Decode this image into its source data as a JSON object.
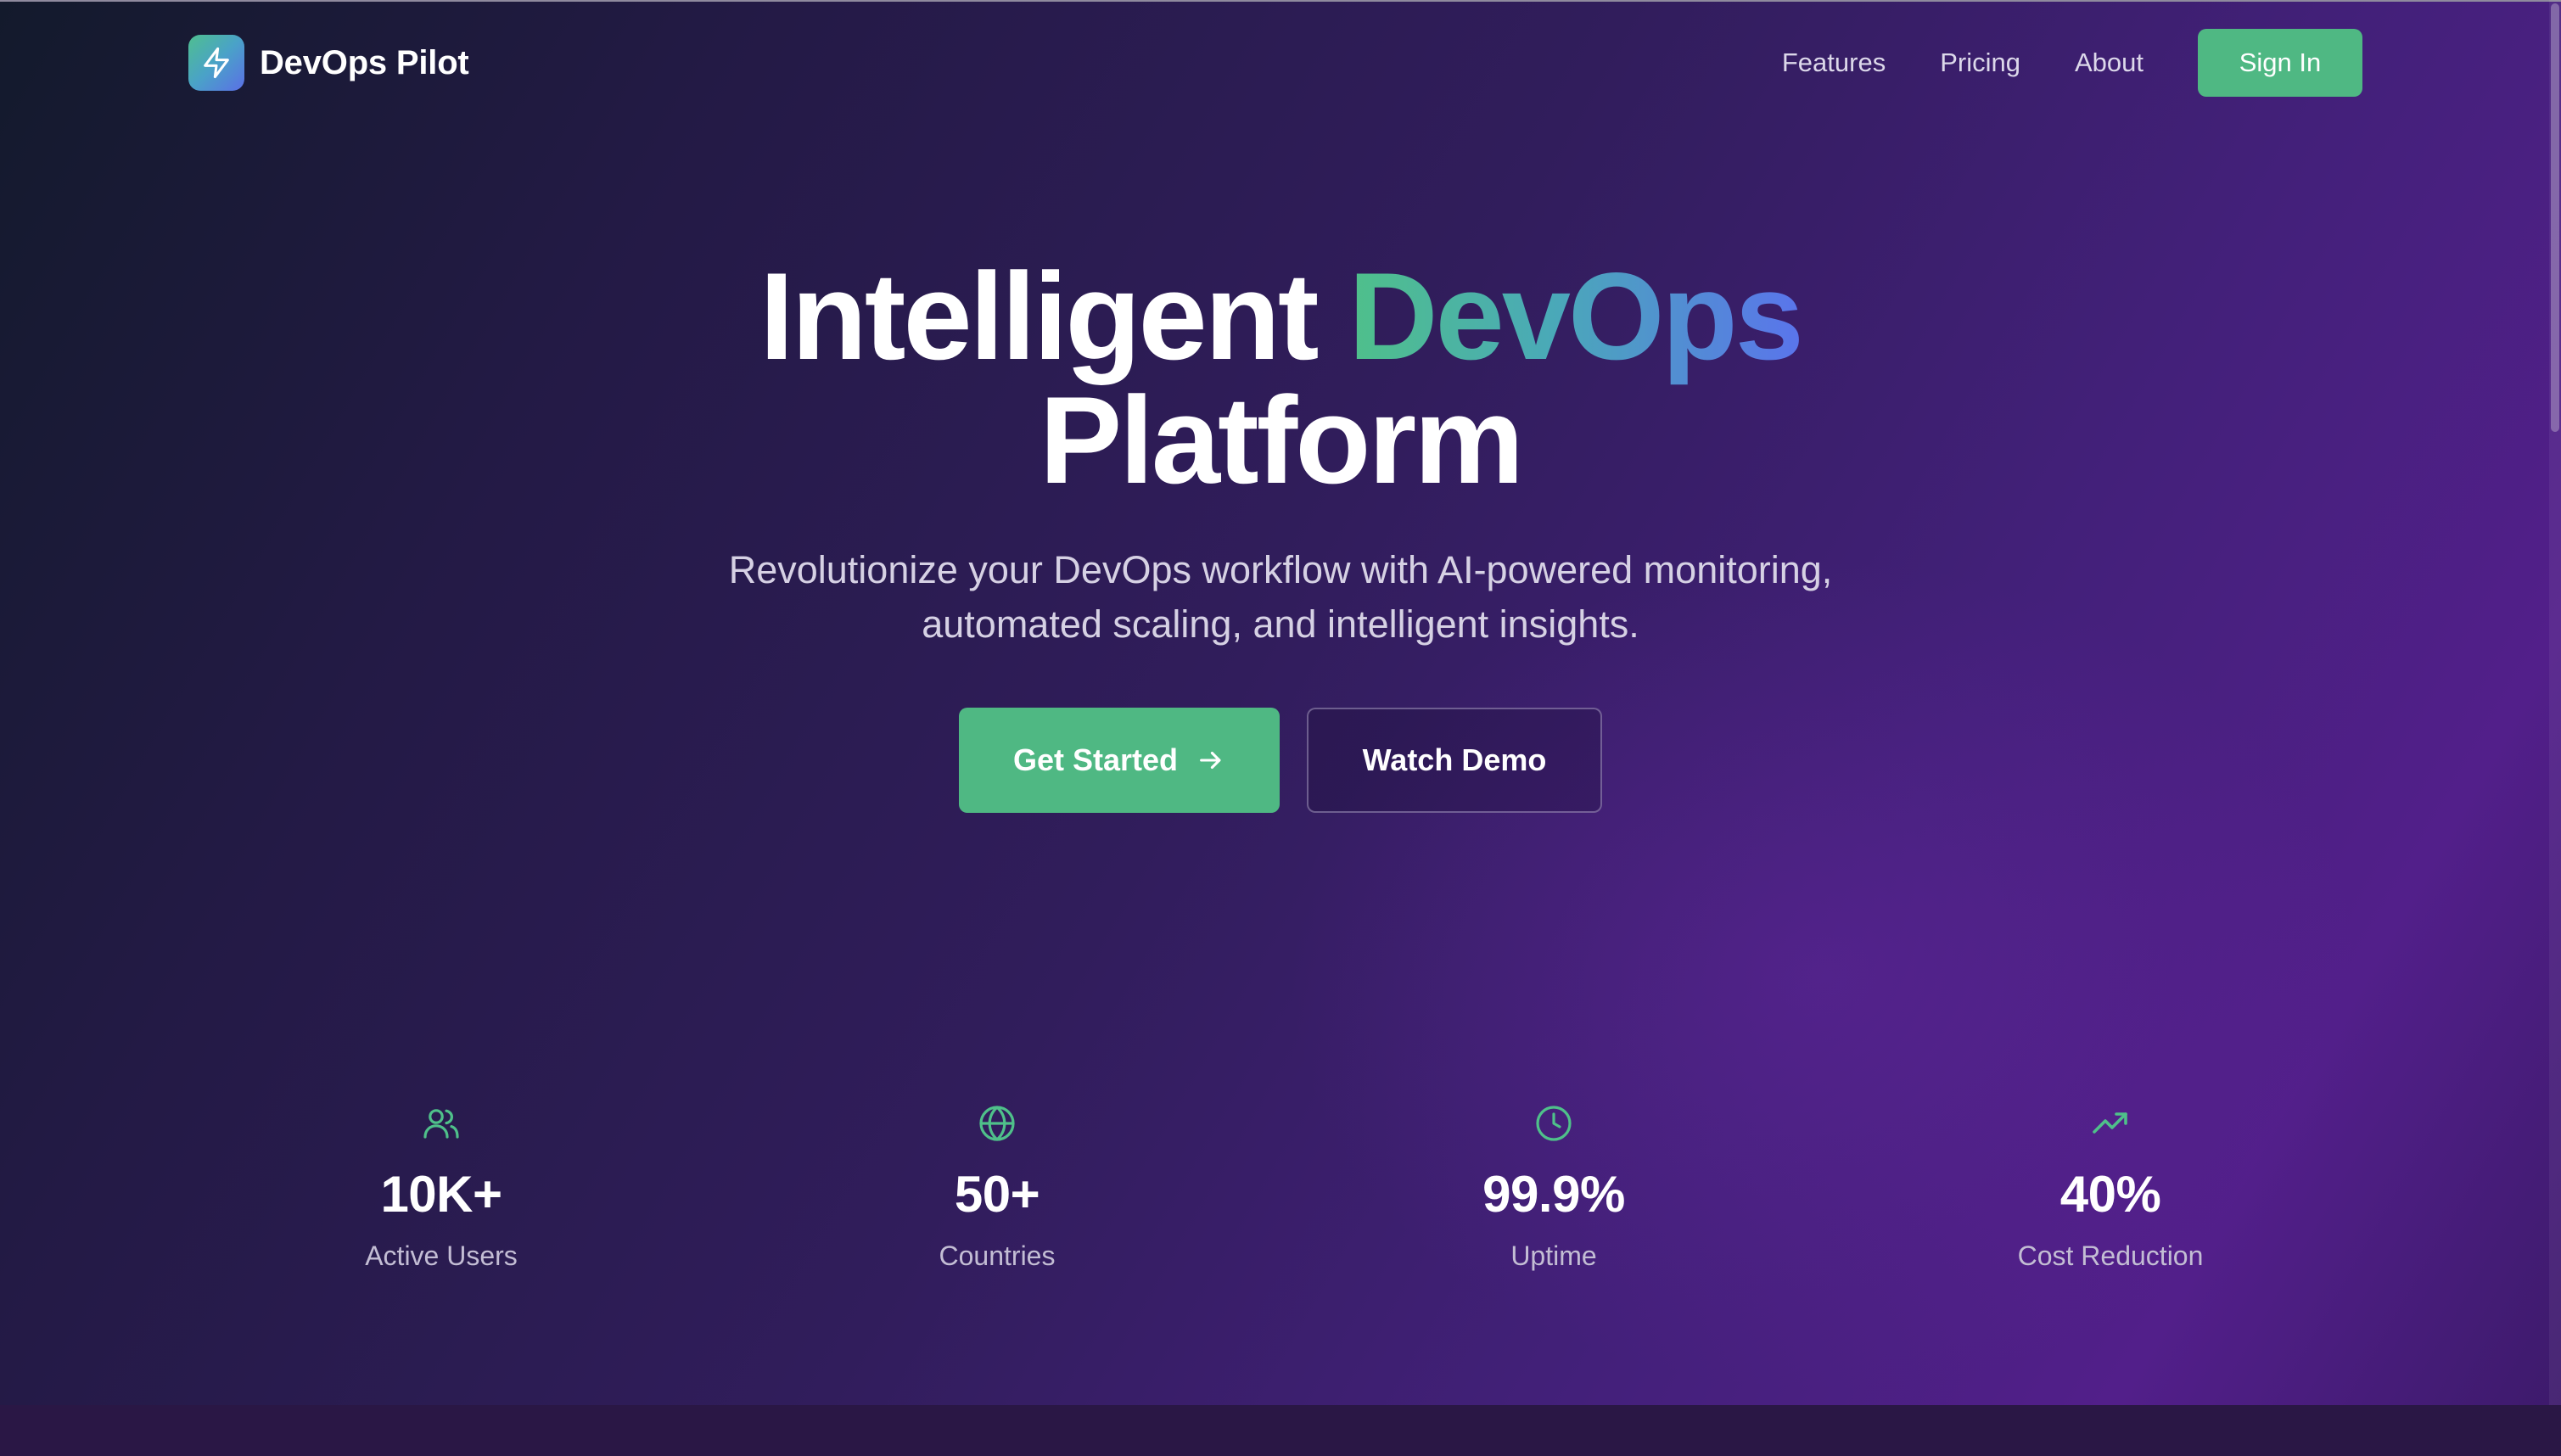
{
  "nav": {
    "brand": "DevOps Pilot",
    "links": [
      "Features",
      "Pricing",
      "About"
    ],
    "signin_label": "Sign In"
  },
  "hero": {
    "title_prefix": "Intelligent",
    "title_highlight": "DevOps",
    "title_line2": "Platform",
    "subtitle_line1": "Revolutionize your DevOps workflow with AI-powered monitoring,",
    "subtitle_line2": "automated scaling, and intelligent insights.",
    "primary_cta": "Get Started",
    "secondary_cta": "Watch Demo"
  },
  "stats": [
    {
      "icon": "users-icon",
      "value": "10K+",
      "label": "Active Users"
    },
    {
      "icon": "globe-icon",
      "value": "50+",
      "label": "Countries"
    },
    {
      "icon": "clock-icon",
      "value": "99.9%",
      "label": "Uptime"
    },
    {
      "icon": "trending-up-icon",
      "value": "40%",
      "label": "Cost Reduction"
    }
  ],
  "colors": {
    "accent_green": "#4fb883",
    "gradient_start": "#4fc08a",
    "gradient_end": "#5a74ec",
    "background_dark": "#131a2c",
    "background_purple": "#521f8a"
  }
}
